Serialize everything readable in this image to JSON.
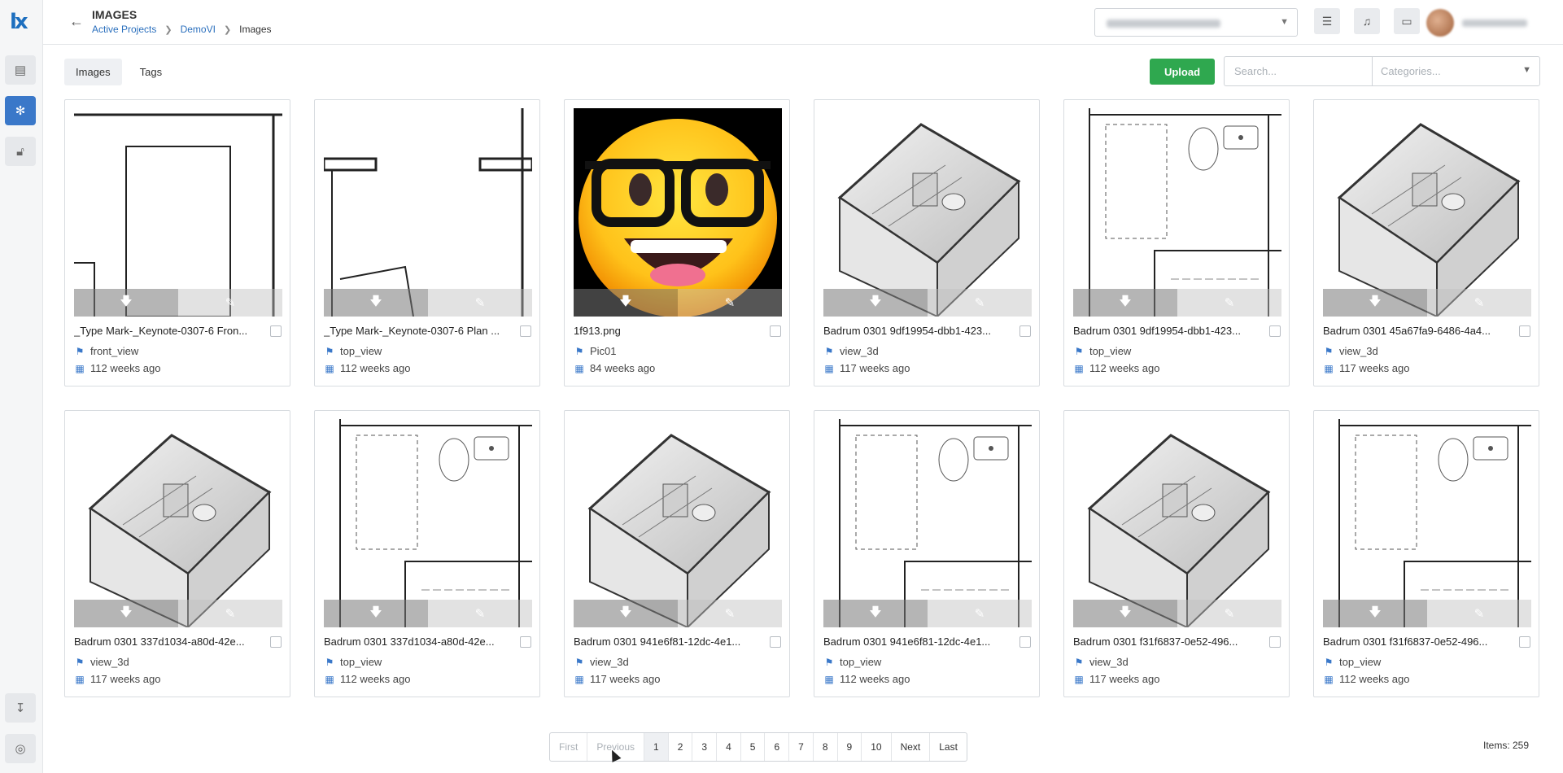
{
  "app": {
    "logo_text": "lx"
  },
  "header": {
    "title": "IMAGES",
    "breadcrumb": [
      "Active Projects",
      "DemoVI",
      "Images"
    ],
    "company_select_value": "",
    "user_name": ""
  },
  "toolbar": {
    "tabs": [
      "Images",
      "Tags"
    ],
    "upload_label": "Upload",
    "search_placeholder": "Search...",
    "categories_placeholder": "Categories..."
  },
  "cards": [
    {
      "title": "_Type Mark-_Keynote-0307-6 Fron...",
      "tag": "front_view",
      "date": "112 weeks ago",
      "thumb": "front"
    },
    {
      "title": "_Type Mark-_Keynote-0307-6 Plan ...",
      "tag": "top_view",
      "date": "112 weeks ago",
      "thumb": "plan"
    },
    {
      "title": "1f913.png",
      "tag": "Pic01",
      "date": "84 weeks ago",
      "thumb": "emoji"
    },
    {
      "title": "Badrum 0301 9df19954-dbb1-423...",
      "tag": "view_3d",
      "date": "117 weeks ago",
      "thumb": "iso"
    },
    {
      "title": "Badrum 0301 9df19954-dbb1-423...",
      "tag": "top_view",
      "date": "112 weeks ago",
      "thumb": "top"
    },
    {
      "title": "Badrum 0301 45a67fa9-6486-4a4...",
      "tag": "view_3d",
      "date": "117 weeks ago",
      "thumb": "iso"
    },
    {
      "title": "Badrum 0301 337d1034-a80d-42e...",
      "tag": "view_3d",
      "date": "117 weeks ago",
      "thumb": "iso"
    },
    {
      "title": "Badrum 0301 337d1034-a80d-42e...",
      "tag": "top_view",
      "date": "112 weeks ago",
      "thumb": "top"
    },
    {
      "title": "Badrum 0301 941e6f81-12dc-4e1...",
      "tag": "view_3d",
      "date": "117 weeks ago",
      "thumb": "iso"
    },
    {
      "title": "Badrum 0301 941e6f81-12dc-4e1...",
      "tag": "top_view",
      "date": "112 weeks ago",
      "thumb": "top"
    },
    {
      "title": "Badrum 0301 f31f6837-0e52-496...",
      "tag": "view_3d",
      "date": "117 weeks ago",
      "thumb": "iso"
    },
    {
      "title": "Badrum 0301 f31f6837-0e52-496...",
      "tag": "top_view",
      "date": "112 weeks ago",
      "thumb": "top"
    }
  ],
  "pagination": {
    "first": "First",
    "previous": "Previous",
    "pages": [
      "1",
      "2",
      "3",
      "4",
      "5",
      "6",
      "7",
      "8",
      "9",
      "10"
    ],
    "current": "1",
    "next": "Next",
    "last": "Last"
  },
  "items_count": "Items: 259",
  "icons": {
    "download": "download-icon",
    "edit": "edit-icon",
    "tag": "tag-icon",
    "calendar": "calendar-icon"
  },
  "colors": {
    "accent": "#3a78c9",
    "upload": "#2fa84f",
    "link": "#2a6fbd"
  }
}
